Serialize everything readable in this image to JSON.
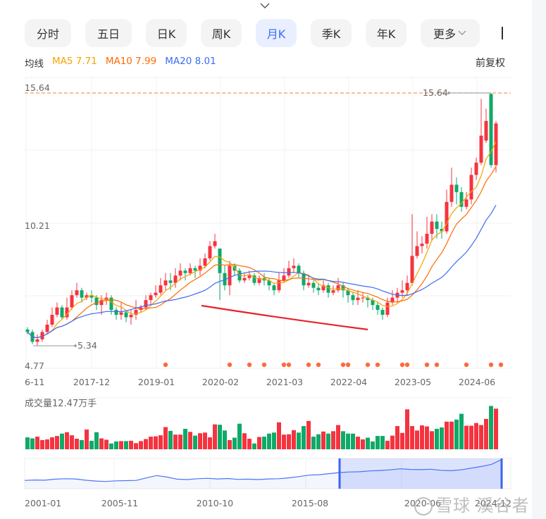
{
  "tabs": [
    {
      "label": "分时",
      "active": false
    },
    {
      "label": "五日",
      "active": false
    },
    {
      "label": "日K",
      "active": false
    },
    {
      "label": "周K",
      "active": false
    },
    {
      "label": "月K",
      "active": true
    },
    {
      "label": "季K",
      "active": false
    },
    {
      "label": "年K",
      "active": false
    },
    {
      "label": "更多",
      "active": false,
      "icon": "chevron-down-icon"
    }
  ],
  "ma_legend": {
    "title": "均线",
    "ma5": "MA5 7.71",
    "ma10": "MA10 7.99",
    "ma20": "MA20 8.01"
  },
  "adjust_mode": "前复权",
  "colors": {
    "up": "#f5333f",
    "down": "#0fa968",
    "ma5": "#f5a300",
    "ma10": "#ff6a00",
    "ma20": "#3d6cf6",
    "accent": "#3b6cf6",
    "event_dot": "#ff6a3d",
    "annotation_line": "#e8202a"
  },
  "watermark": "雪球 溪谷者",
  "chart_data": [
    {
      "type": "candlestick",
      "period": "monthly",
      "y_labels": [
        "15.64",
        "10.21",
        "4.77"
      ],
      "ylim": [
        4.77,
        15.64
      ],
      "max_label": "15.64",
      "min_label": "5.34",
      "reference_line": 15.64,
      "x_tick_labels": [
        "6-11",
        "2017-12",
        "2019-01",
        "2020-02",
        "2021-03",
        "2022-04",
        "2023-05",
        "2024-06"
      ],
      "x_start": "2016-11",
      "candle_fields": [
        "open",
        "close",
        "high",
        "low"
      ],
      "candles": [
        [
          6.0,
          5.9,
          6.1,
          5.8
        ],
        [
          5.9,
          5.5,
          6.0,
          5.4
        ],
        [
          5.5,
          5.6,
          5.8,
          5.34
        ],
        [
          5.6,
          5.9,
          6.0,
          5.5
        ],
        [
          5.9,
          6.2,
          6.4,
          5.8
        ],
        [
          6.2,
          6.6,
          6.9,
          6.1
        ],
        [
          6.6,
          6.9,
          7.1,
          6.5
        ],
        [
          6.9,
          6.5,
          7.0,
          6.4
        ],
        [
          6.5,
          6.9,
          7.3,
          6.4
        ],
        [
          6.9,
          7.4,
          7.6,
          6.8
        ],
        [
          7.4,
          7.6,
          7.9,
          7.3
        ],
        [
          7.6,
          7.3,
          7.7,
          7.1
        ],
        [
          7.3,
          7.4,
          7.5,
          7.2
        ],
        [
          7.4,
          7.3,
          7.6,
          7.1
        ],
        [
          7.3,
          7.0,
          7.4,
          6.8
        ],
        [
          7.0,
          7.2,
          7.4,
          6.6
        ],
        [
          7.2,
          7.3,
          7.5,
          7.0
        ],
        [
          7.3,
          6.8,
          7.4,
          6.6
        ],
        [
          6.8,
          6.6,
          6.9,
          6.4
        ],
        [
          6.6,
          6.7,
          7.1,
          6.4
        ],
        [
          6.7,
          6.5,
          6.8,
          6.3
        ],
        [
          6.5,
          6.6,
          6.8,
          6.2
        ],
        [
          6.6,
          6.8,
          7.2,
          6.4
        ],
        [
          6.8,
          6.9,
          7.0,
          6.7
        ],
        [
          6.9,
          7.2,
          7.4,
          6.8
        ],
        [
          7.2,
          7.4,
          7.5,
          7.0
        ],
        [
          7.4,
          7.5,
          7.8,
          7.3
        ],
        [
          7.5,
          7.8,
          8.1,
          7.4
        ],
        [
          7.8,
          8.0,
          8.3,
          7.6
        ],
        [
          8.0,
          7.9,
          8.3,
          7.6
        ],
        [
          7.9,
          8.2,
          8.5,
          7.7
        ],
        [
          8.2,
          8.4,
          8.7,
          8.0
        ],
        [
          8.4,
          8.3,
          8.5,
          8.0
        ],
        [
          8.3,
          8.5,
          8.7,
          8.2
        ],
        [
          8.5,
          8.4,
          8.6,
          8.1
        ],
        [
          8.4,
          8.6,
          8.9,
          8.2
        ],
        [
          8.6,
          8.9,
          9.1,
          8.5
        ],
        [
          8.9,
          9.4,
          9.6,
          8.8
        ],
        [
          9.4,
          9.6,
          9.9,
          9.3
        ],
        [
          9.3,
          8.3,
          9.3,
          7.2
        ],
        [
          8.3,
          7.8,
          8.6,
          7.6
        ],
        [
          7.8,
          8.6,
          8.8,
          7.4
        ],
        [
          8.6,
          8.4,
          8.7,
          8.2
        ],
        [
          8.4,
          8.0,
          8.5,
          7.9
        ],
        [
          8.0,
          8.1,
          8.3,
          7.9
        ],
        [
          8.1,
          8.2,
          8.4,
          8.0
        ],
        [
          8.2,
          7.9,
          8.3,
          7.8
        ],
        [
          7.9,
          8.1,
          8.2,
          7.8
        ],
        [
          8.1,
          8.0,
          8.3,
          7.8
        ],
        [
          8.0,
          7.8,
          8.1,
          7.6
        ],
        [
          7.8,
          7.6,
          7.9,
          7.4
        ],
        [
          7.6,
          8.0,
          8.3,
          7.5
        ],
        [
          8.0,
          8.2,
          8.5,
          7.9
        ],
        [
          8.2,
          8.5,
          8.8,
          8.1
        ],
        [
          8.5,
          8.6,
          8.9,
          8.3
        ],
        [
          8.6,
          8.3,
          8.7,
          8.1
        ],
        [
          8.3,
          7.8,
          8.4,
          7.6
        ],
        [
          7.8,
          7.9,
          8.2,
          7.7
        ],
        [
          7.9,
          7.7,
          8.0,
          7.5
        ],
        [
          7.7,
          7.6,
          7.9,
          7.4
        ],
        [
          7.6,
          7.8,
          8.0,
          7.5
        ],
        [
          7.8,
          7.5,
          7.9,
          7.3
        ],
        [
          7.5,
          7.6,
          7.8,
          7.4
        ],
        [
          7.6,
          7.8,
          8.1,
          7.5
        ],
        [
          7.8,
          7.6,
          7.9,
          7.3
        ],
        [
          7.6,
          7.4,
          7.7,
          7.1
        ],
        [
          7.4,
          7.2,
          7.5,
          7.0
        ],
        [
          7.2,
          7.3,
          7.6,
          7.0
        ],
        [
          7.3,
          7.3,
          7.5,
          7.1
        ],
        [
          7.3,
          7.2,
          7.4,
          6.9
        ],
        [
          7.2,
          7.0,
          7.3,
          6.8
        ],
        [
          7.0,
          6.8,
          7.1,
          6.6
        ],
        [
          6.8,
          6.6,
          6.9,
          6.4
        ],
        [
          6.6,
          7.1,
          7.3,
          6.5
        ],
        [
          7.1,
          7.3,
          7.6,
          7.0
        ],
        [
          7.3,
          7.5,
          7.7,
          7.1
        ],
        [
          7.5,
          7.6,
          8.0,
          7.3
        ],
        [
          7.6,
          7.9,
          8.2,
          7.4
        ],
        [
          7.9,
          9.0,
          10.7,
          7.8
        ],
        [
          9.0,
          9.4,
          10.0,
          8.9
        ],
        [
          9.4,
          9.5,
          9.8,
          9.1
        ],
        [
          9.5,
          9.9,
          10.6,
          9.3
        ],
        [
          9.9,
          10.4,
          10.7,
          9.6
        ],
        [
          10.4,
          10.1,
          10.7,
          9.7
        ],
        [
          10.1,
          10.0,
          10.4,
          9.7
        ],
        [
          10.0,
          11.2,
          11.7,
          9.9
        ],
        [
          11.2,
          11.9,
          12.6,
          11.0
        ],
        [
          11.9,
          11.6,
          12.2,
          11.1
        ],
        [
          11.6,
          11.0,
          11.8,
          10.8
        ],
        [
          11.0,
          11.3,
          11.6,
          10.9
        ],
        [
          11.3,
          12.3,
          12.6,
          11.1
        ],
        [
          12.3,
          12.8,
          13.0,
          12.1
        ],
        [
          12.8,
          13.9,
          15.4,
          12.7
        ],
        [
          13.7,
          14.5,
          15.0,
          13.6
        ],
        [
          15.6,
          12.7,
          15.64,
          12.6
        ],
        [
          12.7,
          14.4,
          14.5,
          12.4
        ]
      ],
      "moving_averages": [
        "MA5",
        "MA10",
        "MA20"
      ],
      "event_marker_months": [
        "2019-03",
        "2020-04",
        "2020-08",
        "2020-11",
        "2021-03",
        "2021-04",
        "2021-08",
        "2021-10",
        "2022-03",
        "2022-04",
        "2022-08",
        "2022-10",
        "2023-03",
        "2023-04",
        "2023-08",
        "2023-10",
        "2024-04",
        "2024-09",
        "2024-11"
      ]
    },
    {
      "type": "bar",
      "title": "成交量12.47万手",
      "unit": "万手",
      "values": [
        3.5,
        3.2,
        3.7,
        2.7,
        2.9,
        3.5,
        3.9,
        4.6,
        5.0,
        4.1,
        3.1,
        2.7,
        5.8,
        2.5,
        5.0,
        3.2,
        2.8,
        1.7,
        2.3,
        2.4,
        2.4,
        2.5,
        1.8,
        2.4,
        3.0,
        3.7,
        3.8,
        4.1,
        6.5,
        5.4,
        4.3,
        4.3,
        6.0,
        5.1,
        4.0,
        4.7,
        4.9,
        3.5,
        7.3,
        7.2,
        5.5,
        2.7,
        3.4,
        7.5,
        4.7,
        3.1,
        1.7,
        3.6,
        3.7,
        4.6,
        4.9,
        7.9,
        4.3,
        4.4,
        5.6,
        4.9,
        6.8,
        8.3,
        3.7,
        4.4,
        5.2,
        4.6,
        5.3,
        7.1,
        5.3,
        4.6,
        4.6,
        3.7,
        2.9,
        3.4,
        2.3,
        3.9,
        3.9,
        2.5,
        4.0,
        6.8,
        4.8,
        11.7,
        6.8,
        5.5,
        7.0,
        6.7,
        5.3,
        6.0,
        6.4,
        8.1,
        8.1,
        8.7,
        10.4,
        6.9,
        6.9,
        7.7,
        7.1,
        8.9,
        12.7,
        11.9
      ],
      "ylim": [
        0,
        13
      ]
    },
    {
      "type": "area",
      "x_tick_labels": [
        "2001-01",
        "2005-11",
        "2010-10",
        "2015-08",
        "2020-06",
        "2024-12"
      ],
      "values": [
        2.6,
        2.8,
        2.7,
        3.2,
        3.4,
        3.3,
        2.7,
        2.3,
        2.1,
        2.4,
        2.5,
        2.6,
        3.8,
        4.9,
        4.2,
        3.2,
        3.0,
        3.4,
        3.6,
        3.3,
        3.5,
        3.1,
        3.2,
        3.0,
        3.3,
        3.4,
        3.8,
        4.4,
        5.1,
        5.3,
        5.8,
        6.3,
        6.6,
        6.7,
        7.1,
        7.3,
        7.6,
        8.1,
        7.8,
        7.7,
        7.9,
        7.4,
        7.2,
        7.6,
        8.4,
        9.2,
        10.2,
        12.5
      ],
      "selected_range": [
        "2016-11",
        "2024-12"
      ]
    }
  ]
}
